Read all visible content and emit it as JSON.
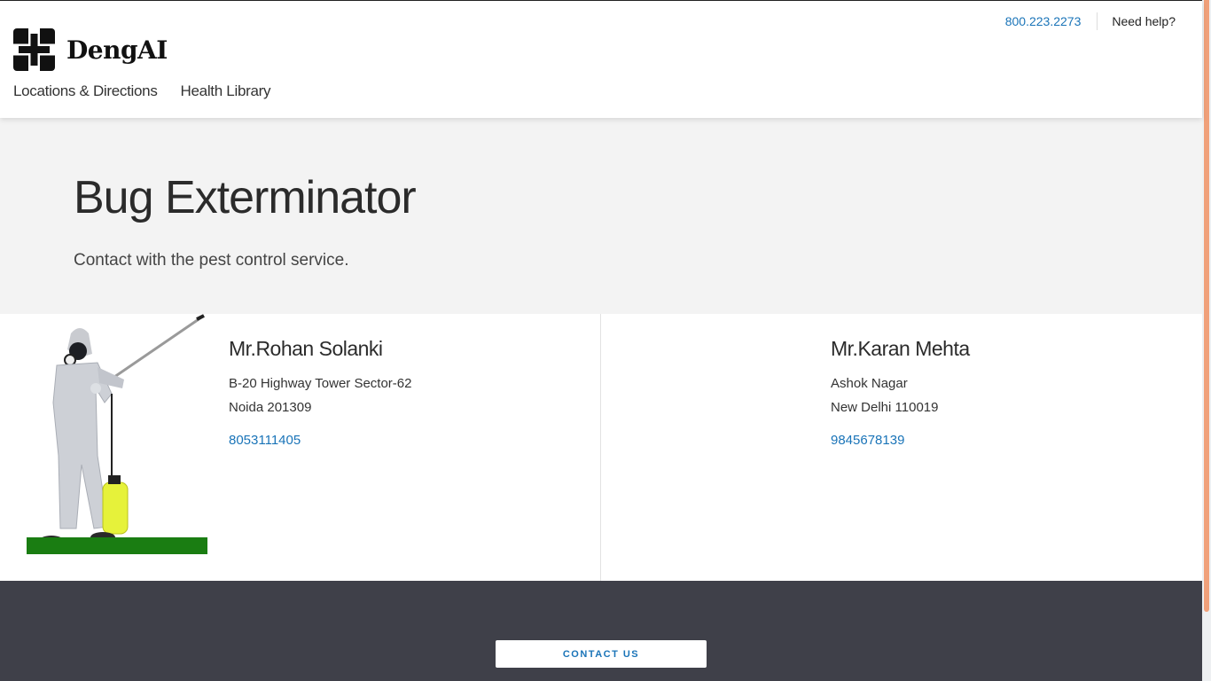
{
  "brand": {
    "name": "DengAI"
  },
  "utility": {
    "phone": "800.223.2273",
    "help": "Need help?"
  },
  "nav": {
    "items": [
      "Locations & Directions",
      "Health Library"
    ]
  },
  "hero": {
    "title": "Bug Exterminator",
    "subtitle": "Contact with the pest control service."
  },
  "contacts": [
    {
      "name": "Mr.Rohan Solanki",
      "address_line1": "B-20 Highway Tower Sector-62",
      "address_line2": "Noida 201309",
      "phone": "8053111405"
    },
    {
      "name": "Mr.Karan Mehta",
      "address_line1": "Ashok Nagar",
      "address_line2": "New Delhi 110019",
      "phone": "9845678139"
    }
  ],
  "footer": {
    "cta_label": "CONTACT US"
  },
  "colors": {
    "link": "#1a74b8",
    "hero_bg": "#f3f3f3",
    "footer_bg": "#3f4049",
    "grass": "#1a7d12",
    "sprayer_tank": "#e6f23a"
  },
  "icons": {
    "logo": "cross-logo-icon",
    "photo": "exterminator-photo"
  }
}
